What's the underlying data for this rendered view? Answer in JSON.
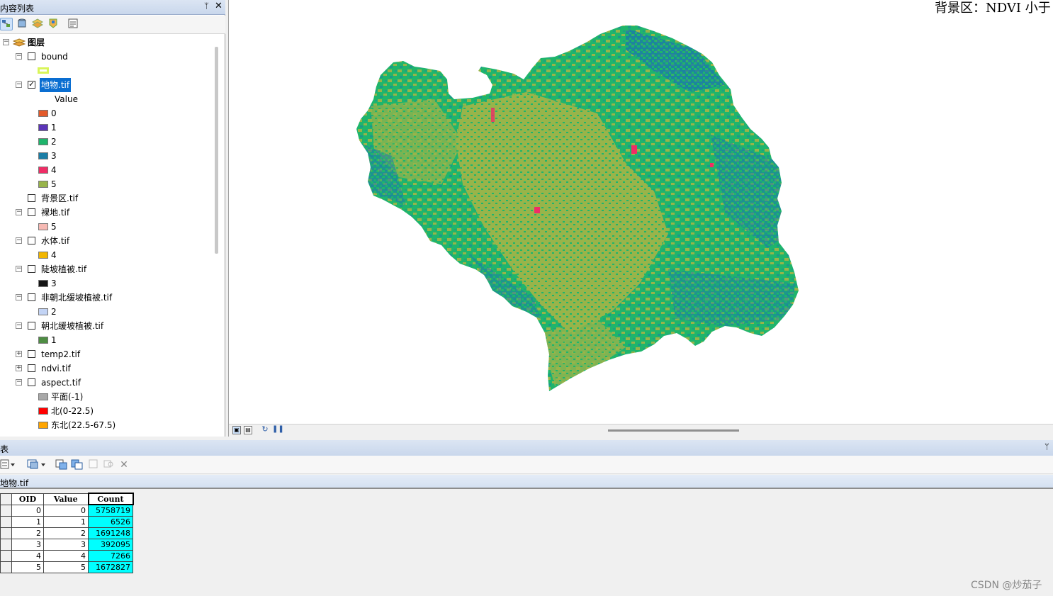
{
  "toc": {
    "title": "内容列表",
    "pin": "ᛘ",
    "close": "✕",
    "root_label": "图层",
    "layers": [
      {
        "name": "bound",
        "checked": false,
        "expanded": true
      },
      {
        "name": "地物.tif",
        "checked": true,
        "expanded": true,
        "selected": true,
        "field": "Value",
        "classes": [
          {
            "label": "0",
            "color": "#e35a2a"
          },
          {
            "label": "1",
            "color": "#5b34b8"
          },
          {
            "label": "2",
            "color": "#1fb56c"
          },
          {
            "label": "3",
            "color": "#1b7ea6"
          },
          {
            "label": "4",
            "color": "#ef2d66"
          },
          {
            "label": "5",
            "color": "#98b44a"
          }
        ]
      },
      {
        "name": "背景区.tif",
        "checked": false,
        "expanded": false
      },
      {
        "name": "裸地.tif",
        "checked": false,
        "expanded": true,
        "classes": [
          {
            "label": "5",
            "color": "#f6b9b3"
          }
        ]
      },
      {
        "name": "水体.tif",
        "checked": false,
        "expanded": true,
        "classes": [
          {
            "label": "4",
            "color": "#f1b600"
          }
        ]
      },
      {
        "name": "陡坡植被.tif",
        "checked": false,
        "expanded": true,
        "classes": [
          {
            "label": "3",
            "color": "#141414"
          }
        ]
      },
      {
        "name": "非朝北缓坡植被.tif",
        "checked": false,
        "expanded": true,
        "classes": [
          {
            "label": "2",
            "color": "#c3d4f5"
          }
        ]
      },
      {
        "name": "朝北缓坡植被.tif",
        "checked": false,
        "expanded": true,
        "classes": [
          {
            "label": "1",
            "color": "#4e8d43"
          }
        ]
      },
      {
        "name": "temp2.tif",
        "checked": false,
        "expanded": false
      },
      {
        "name": "ndvi.tif",
        "checked": false,
        "expanded": false
      },
      {
        "name": "aspect.tif",
        "checked": false,
        "expanded": true,
        "classes": [
          {
            "label": "平面(-1)",
            "color": "#a8a8a8"
          },
          {
            "label": "北(0-22.5)",
            "color": "#ff0000"
          },
          {
            "label": "东北(22.5-67.5)",
            "color": "#ffa500"
          }
        ]
      }
    ],
    "bound_symbol_color": "#d9f55a"
  },
  "map": {
    "title_text": "背景区：NDVI 小于"
  },
  "table": {
    "title": "表",
    "tab_label": "地物.tif",
    "columns": [
      "OID",
      "Value",
      "Count"
    ],
    "rows": [
      [
        "0",
        "0",
        "5758719"
      ],
      [
        "1",
        "1",
        "6526"
      ],
      [
        "2",
        "2",
        "1691248"
      ],
      [
        "3",
        "3",
        "392095"
      ],
      [
        "4",
        "4",
        "7266"
      ],
      [
        "5",
        "5",
        "1672827"
      ]
    ]
  },
  "watermark": "CSDN @炒茄子"
}
